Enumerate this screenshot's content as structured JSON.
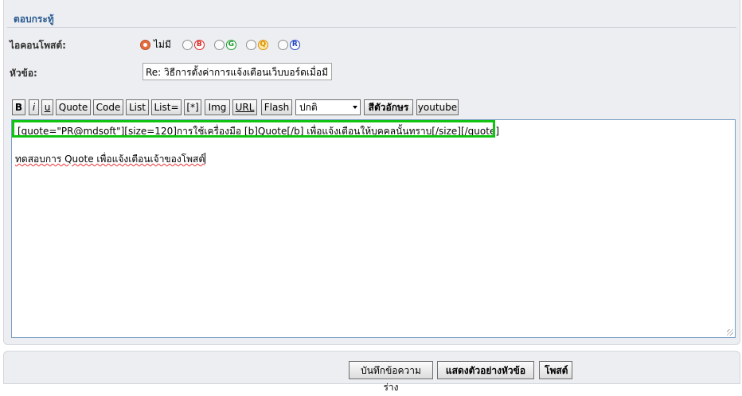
{
  "panel": {
    "title": "ตอบกระทู้"
  },
  "icon_row": {
    "label": "ไอคอนโพสต์:",
    "none_label": "ไม่มี",
    "icons": [
      {
        "letter": "B",
        "name": "b"
      },
      {
        "letter": "G",
        "name": "g"
      },
      {
        "letter": "Q",
        "name": "q"
      },
      {
        "letter": "R",
        "name": "r"
      }
    ]
  },
  "subject": {
    "label": "หัวข้อ:",
    "value": "Re: วิธีการตั้งค่าการแจ้งเตือนเว็บบอร์ดเมื่อมี"
  },
  "toolbar": {
    "buttons": [
      "B",
      "i",
      "u",
      "Quote",
      "Code",
      "List",
      "List=",
      "[*]",
      "Img",
      "URL",
      "Flash"
    ],
    "select_value": "ปกติ",
    "color_button": "สีตัวอักษร",
    "youtube_button": "youtube"
  },
  "editor": {
    "quote_line": "[quote=\"PR@mdsoft\"][size=120]การใช้เครื่องมือ [b]Quote[/b] เพื่อแจ้งเตือนให้บุคคลนั้นทราบ[/size][/quote]",
    "body_line": "ทดสอบการ Quote เพื่อแจ้งเตือนเจ้าของโพสต์"
  },
  "footer": {
    "save_draft": "บันทึกข้อความร่าง",
    "preview": "แสดงตัวอย่างหัวข้อ",
    "post": "โพสต์"
  }
}
